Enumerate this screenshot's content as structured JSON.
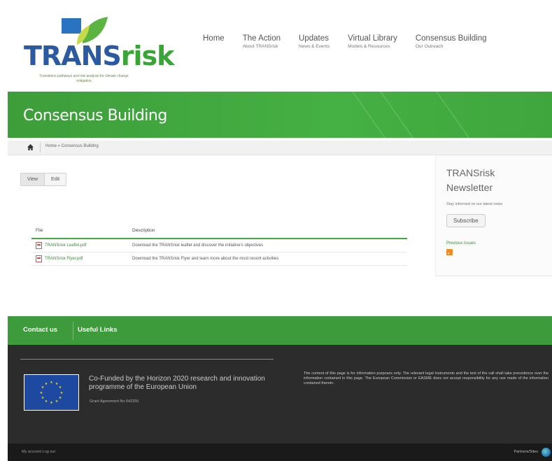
{
  "header": {
    "logo_text_1": "TRANS",
    "logo_text_2": "risk",
    "logo_tagline": "Transitions pathways and risk analysis for climate change mitigation",
    "nav": [
      {
        "label": "Home",
        "sub": ""
      },
      {
        "label": "The Action",
        "sub": "About TRANSrisk"
      },
      {
        "label": "Updates",
        "sub": "News & Events"
      },
      {
        "label": "Virtual Library",
        "sub": "Models & Resources"
      },
      {
        "label": "Consensus Building",
        "sub": "Our Outreach"
      }
    ]
  },
  "banner": {
    "title": "Consensus Building"
  },
  "breadcrumb": {
    "text": "Home » Consensus Building"
  },
  "tabs": [
    {
      "label": "View"
    },
    {
      "label": "Edit"
    }
  ],
  "files": {
    "headers": {
      "file": "File",
      "description": "Description"
    },
    "rows": [
      {
        "file": "TRANSrisk Leaflet.pdf",
        "description": "Download the TRANSrisk leaflet and discover the initiative's objectives"
      },
      {
        "file": "TRANSrisk Flyer.pdf",
        "description": "Download the TRANSrisk Flyer and learn more about the most recent activities"
      }
    ]
  },
  "sidebar": {
    "title": "TRANSrisk Newsletter",
    "subtitle": "Stay informed on our latest news",
    "subscribe_label": "Subscribe",
    "previous_label": "Previous issues"
  },
  "footer": {
    "links": [
      {
        "label": "Contact us"
      },
      {
        "label": "Useful Links"
      }
    ],
    "cofund": "Co-Funded by the Horizon 2020 research and innovation programme of the European Union",
    "grant": "Grant Agreement No 642260",
    "disclaimer": "The content of this page is for information purposes only. The relevant legal instruments and the text of the call shall take precedence over the information contained in this page. The European Commission or EASME does not accept responsibility for any use made of the information contained therein.",
    "bottom_left": "My account   Log out",
    "bottom_right": "Partners/Sites"
  },
  "colors": {
    "brand_green": "#45a943",
    "brand_blue": "#2c5aa0",
    "dark": "#2c2c2c"
  }
}
